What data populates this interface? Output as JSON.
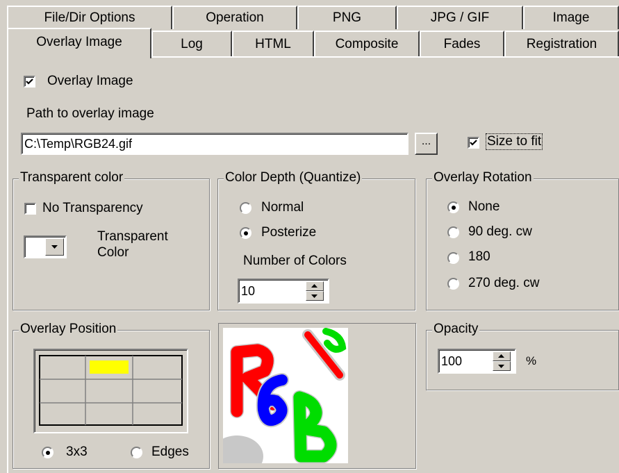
{
  "tabs_row1": [
    "File/Dir Options",
    "Operation",
    "PNG",
    "JPG / GIF",
    "Image"
  ],
  "tabs_row2": [
    "Overlay Image",
    "Log",
    "HTML",
    "Composite",
    "Fades",
    "Registration"
  ],
  "overlay": {
    "enable_label": "Overlay Image",
    "enable_checked": true,
    "path_label": "Path to overlay image",
    "path_value": "C:\\Temp\\RGB24.gif",
    "browse_label": "...",
    "size_to_fit_label": "Size to fit",
    "size_to_fit_checked": true
  },
  "transparent": {
    "title": "Transparent color",
    "no_transparency_label": "No Transparency",
    "color_label_1": "Transparent",
    "color_label_2": "Color"
  },
  "color_depth": {
    "title": "Color Depth (Quantize)",
    "normal_label": "Normal",
    "posterize_label": "Posterize",
    "selected": "Posterize",
    "num_colors_label": "Number of Colors",
    "num_colors_value": "10"
  },
  "rotation": {
    "title": "Overlay Rotation",
    "options": [
      "None",
      "90 deg. cw",
      "180",
      "270 deg. cw"
    ],
    "selected": "None"
  },
  "position": {
    "title": "Overlay Position",
    "mode_3x3_label": "3x3",
    "mode_edges_label": "Edges",
    "selected_mode": "3x3",
    "selected_cell": "top-center",
    "highlight_color": "#ffff00"
  },
  "opacity": {
    "title": "Opacity",
    "value": "100",
    "unit": "%"
  },
  "preview": {
    "letters": [
      "R",
      "G",
      "B"
    ],
    "colors": {
      "r": "#ff0000",
      "g": "#00cc00",
      "b": "#0000ff",
      "shadow": "#c8c8c8"
    }
  }
}
